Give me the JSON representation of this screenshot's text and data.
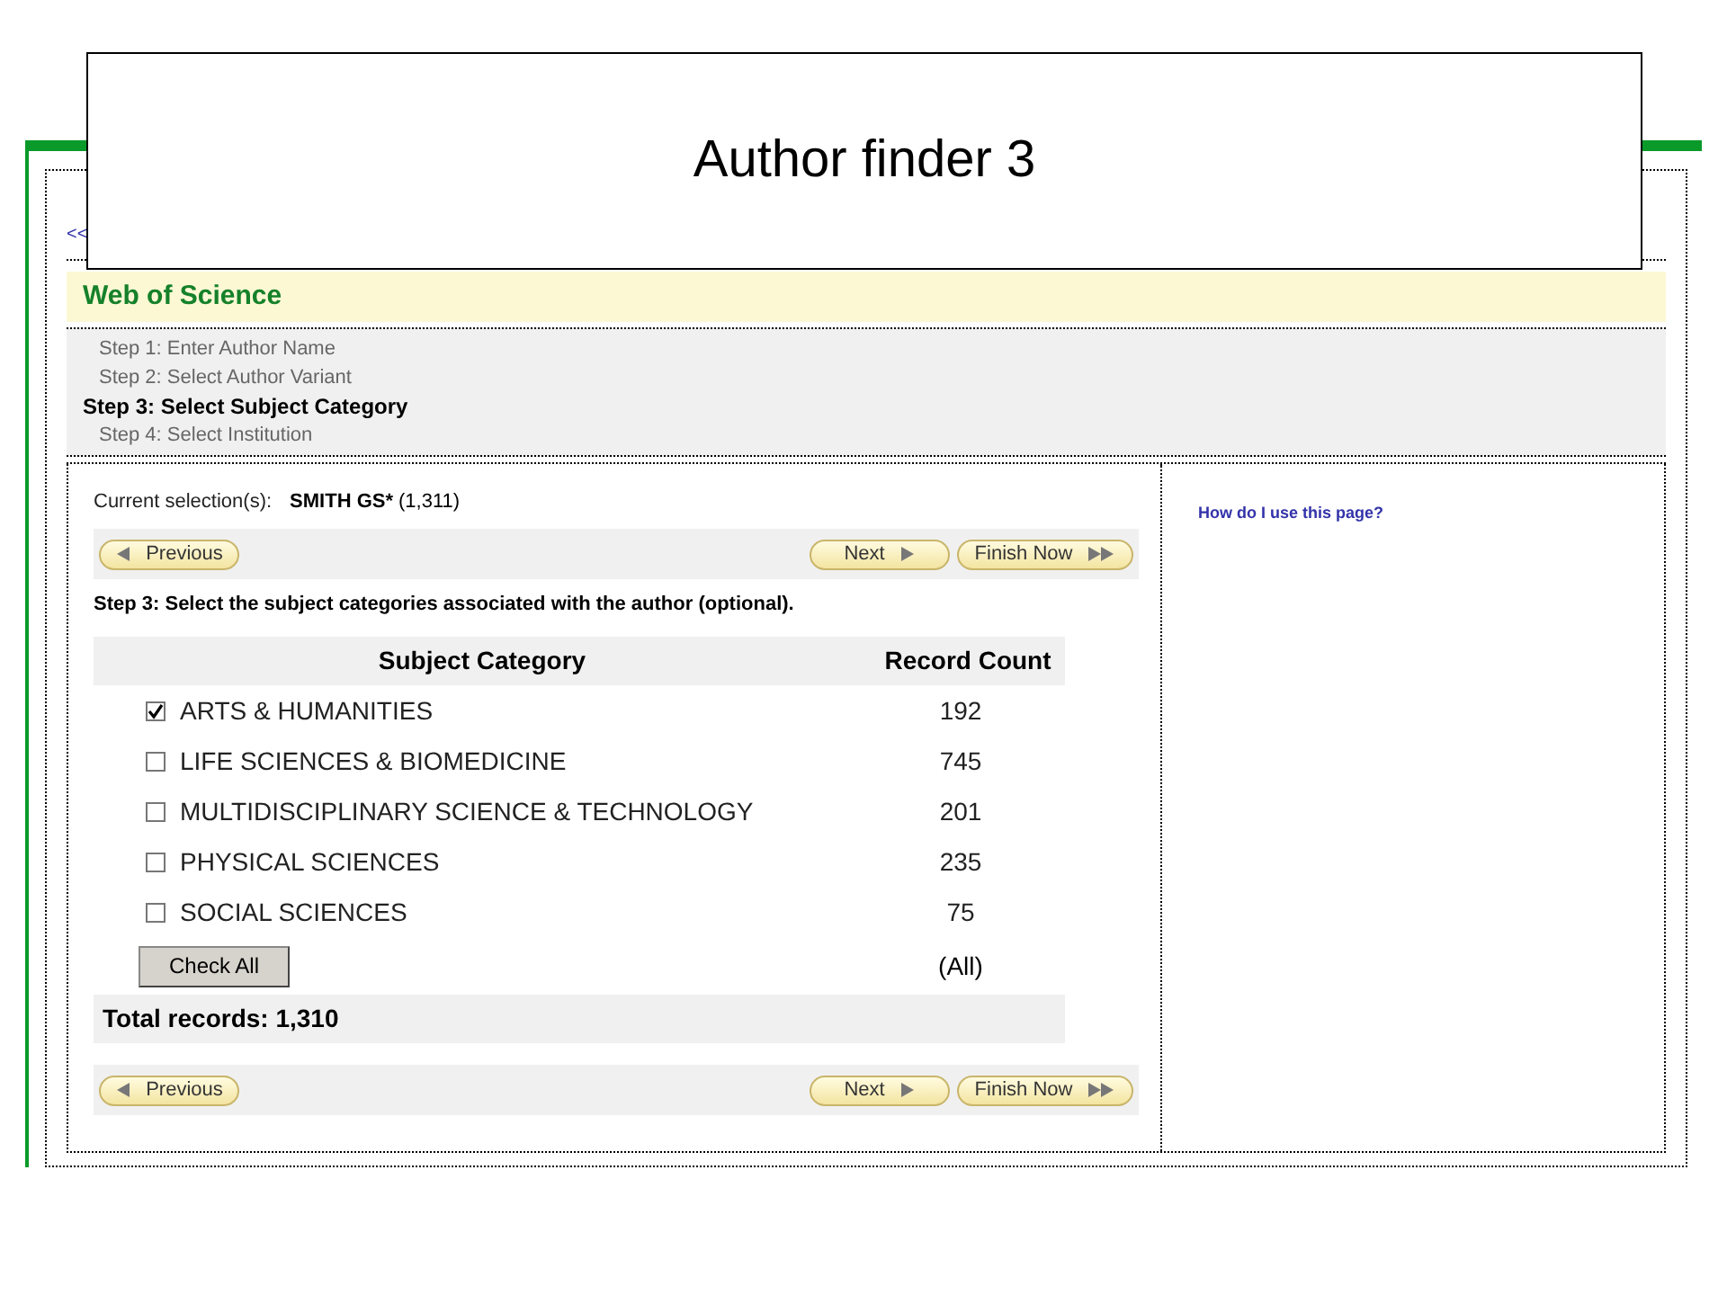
{
  "slide_title": "Author finder 3",
  "back_link": "<<",
  "product": "Web of Science",
  "steps": [
    {
      "label": "Step 1: Enter Author Name",
      "selected": false
    },
    {
      "label": "Step 2: Select Author Variant",
      "selected": false
    },
    {
      "label": "Step 3: Select Subject Category",
      "selected": true
    },
    {
      "label": "Step 4: Select Institution",
      "selected": false
    }
  ],
  "current_selection": {
    "label": "Current selection(s):",
    "name": "SMITH GS*",
    "count": "(1,311)"
  },
  "nav_top": {
    "previous": "Previous",
    "next": "Next",
    "finish": "Finish Now"
  },
  "instruction": "Step 3: Select the subject categories associated with the author (optional).",
  "table": {
    "columns": [
      "Subject Category",
      "Record Count"
    ],
    "rows": [
      {
        "category": "ARTS & HUMANITIES",
        "count": "192",
        "checked": true
      },
      {
        "category": "LIFE SCIENCES & BIOMEDICINE",
        "count": "745",
        "checked": false
      },
      {
        "category": "MULTIDISCIPLINARY SCIENCE & TECHNOLOGY",
        "count": "201",
        "checked": false
      },
      {
        "category": "PHYSICAL SCIENCES",
        "count": "235",
        "checked": false
      },
      {
        "category": "SOCIAL SCIENCES",
        "count": "75",
        "checked": false
      }
    ],
    "check_all": "Check All",
    "all_label": "(All)",
    "total": "Total records: 1,310"
  },
  "nav_bottom": {
    "previous": "Previous",
    "next": "Next",
    "finish": "Finish Now"
  },
  "help_link": "How do I use this page?"
}
